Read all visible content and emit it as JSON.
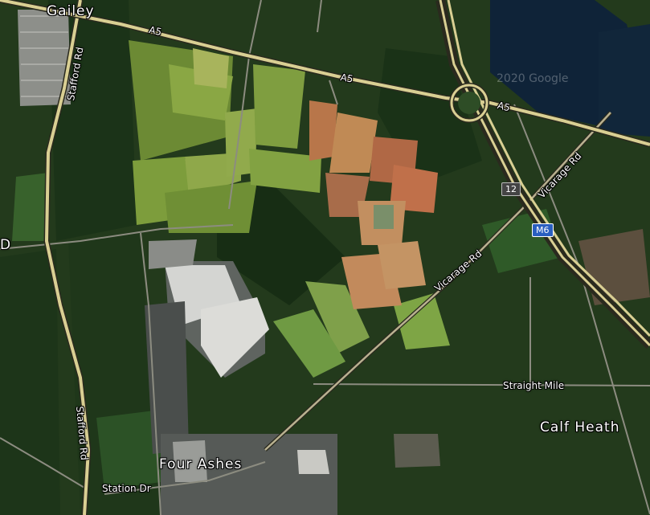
{
  "map": {
    "type": "satellite",
    "places": {
      "gailey": "Gailey",
      "four_ashes": "Four Ashes",
      "calf_heath": "Calf Heath",
      "edge_letter": "D"
    },
    "roads": {
      "a5_west": "A5",
      "a5_mid": "A5",
      "a5_east": "A5",
      "stafford_rd_north": "Stafford Rd",
      "stafford_rd_south": "Stafford Rd",
      "vicarage_rd_south": "Vicarage Rd",
      "vicarage_rd_north": "Vicarage Rd",
      "straight_mile": "Straight Mile",
      "station_dr": "Station Dr"
    },
    "shields": {
      "motorway": "M6",
      "junction": "12"
    },
    "watermark": "2020 Google",
    "colors": {
      "road_casing": "#2a2a1e",
      "road_fill": "#d9cf93",
      "minor_road": "#8c8c80",
      "motorway_shield": "#2a5fc0",
      "water": "#0f2338",
      "bare_soil": "#b36a45",
      "industrial_roof": "#d6d6d6"
    }
  }
}
